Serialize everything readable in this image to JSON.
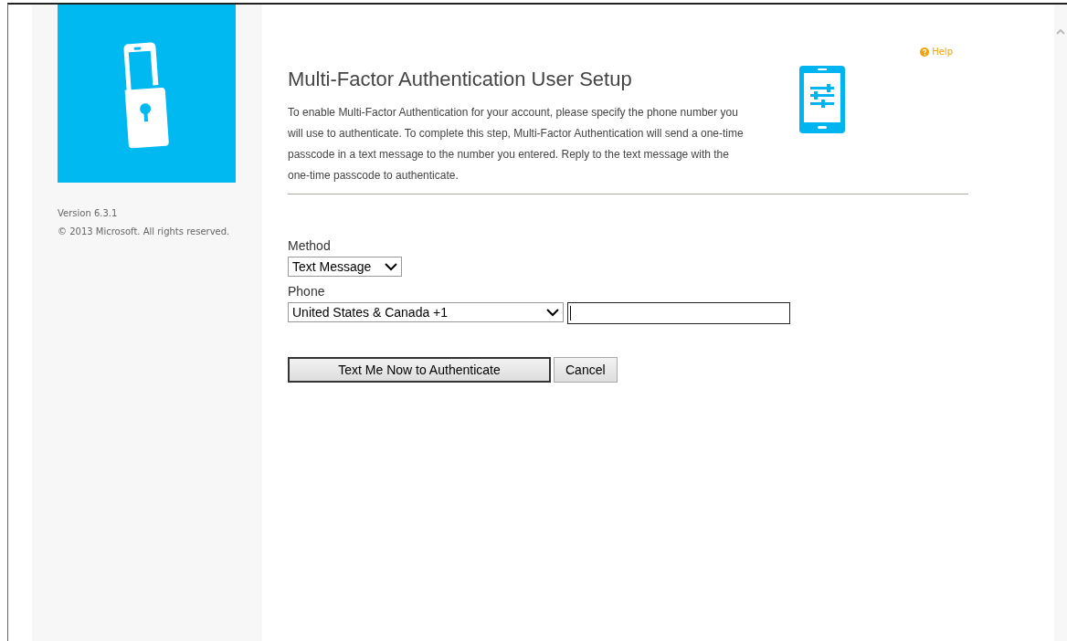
{
  "sidebar": {
    "version": "Version 6.3.1",
    "copyright": "© 2013 Microsoft. All rights reserved."
  },
  "help_link": "Help",
  "title": "Multi-Factor Authentication User Setup",
  "description": "To enable Multi-Factor Authentication for your account, please specify the phone number you will use to authenticate. To complete this step, Multi-Factor Authentication will send a one-time passcode in a text message to the number you entered. Reply to the text message with the one-time passcode to authenticate.",
  "form": {
    "method_label": "Method",
    "method_value": "Text Message",
    "phone_label": "Phone",
    "country_value": "United States & Canada +1"
  },
  "buttons": [
    {
      "label": "Text Me Now to Authenticate",
      "kind": "primary"
    },
    {
      "label": "Cancel",
      "kind": "secondary"
    }
  ]
}
